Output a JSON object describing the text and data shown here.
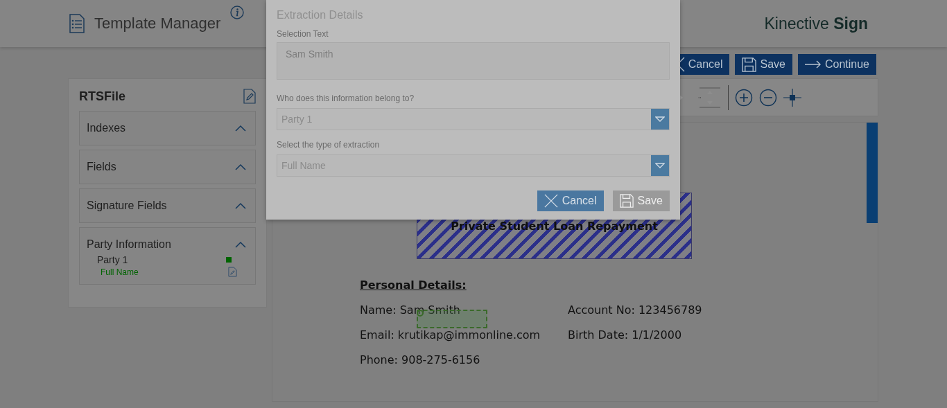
{
  "header": {
    "title": "Template Manager",
    "brand": "Kinective **Sign**"
  },
  "actions": [
    {
      "label": "Cancel",
      "kind": "cancel"
    },
    {
      "label": "Save",
      "kind": "save"
    },
    {
      "label": "Continue",
      "kind": "continue"
    }
  ],
  "sidebar": {
    "title": "RTSFile",
    "sections": [
      {
        "label": "Indexes",
        "expanded": true
      },
      {
        "label": "Fields",
        "expanded": true
      },
      {
        "label": "Signature Fields",
        "expanded": true
      },
      {
        "label": "Party Information",
        "expanded": true,
        "parties": [
          {
            "name": "Party 1",
            "color": "#006400",
            "fields": [
              "Full Name"
            ]
          }
        ]
      }
    ]
  },
  "document": {
    "heading": "Private Student Loan Repayment",
    "section_title": "Personal Details:",
    "rows": [
      [
        {
          "label": "Name:",
          "value": "Sam Smith"
        },
        {
          "label": "Account No:",
          "value": "123456789"
        }
      ],
      [
        {
          "label": "Email:",
          "value": "krutikap@immonline.com"
        },
        {
          "label": "Birth Date:",
          "value": "1/1/2000"
        }
      ],
      [
        {
          "label": "Phone:",
          "value": "908-275-6156"
        }
      ]
    ]
  },
  "dialog": {
    "title": "Extraction Details",
    "selection_label": "Selection Text",
    "selection_value": "Sam Smith",
    "owner_label": "Who does this information belong to?",
    "owner_value": "Party 1",
    "type_label": "Select the type of extraction",
    "type_value": "Full Name",
    "buttons": [
      {
        "label": "Cancel",
        "kind": "cancel",
        "disabled": false
      },
      {
        "label": "Save",
        "kind": "save",
        "disabled": true
      }
    ]
  }
}
